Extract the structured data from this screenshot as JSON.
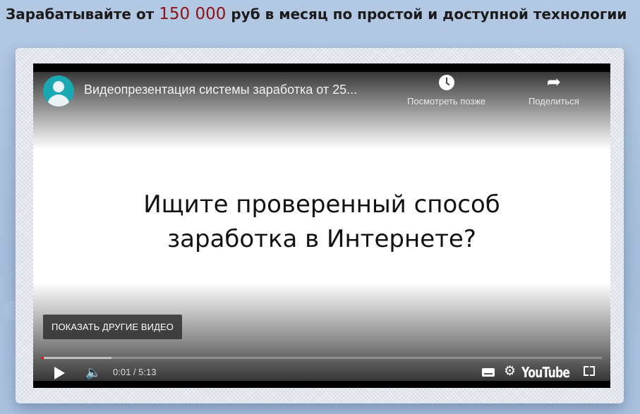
{
  "headline": {
    "before": "Зарабатывайте  от ",
    "amount": "150 000",
    "after": " руб в месяц по простой и доступной технологии"
  },
  "video": {
    "title": "Видеопрезентация системы заработка от 25...",
    "watch_later_label": "Посмотреть позже",
    "share_label": "Поделиться",
    "slide_line1": "Ищите проверенный способ",
    "slide_line2": "заработка в Интернете?",
    "more_videos_label": "ПОКАЗАТЬ ДРУГИЕ ВИДЕО",
    "time_display": "0:01 / 5:13",
    "progress_played_fraction": 0.0033,
    "progress_loaded_fraction": 0.125,
    "brand_label": "YouTube",
    "colors": {
      "progress": "#ff0000",
      "accent": "#8b1318"
    },
    "icons": [
      "avatar-icon",
      "clock-icon",
      "share-icon",
      "play-icon",
      "volume-icon",
      "captions-icon",
      "gear-icon",
      "fullscreen-icon"
    ]
  }
}
